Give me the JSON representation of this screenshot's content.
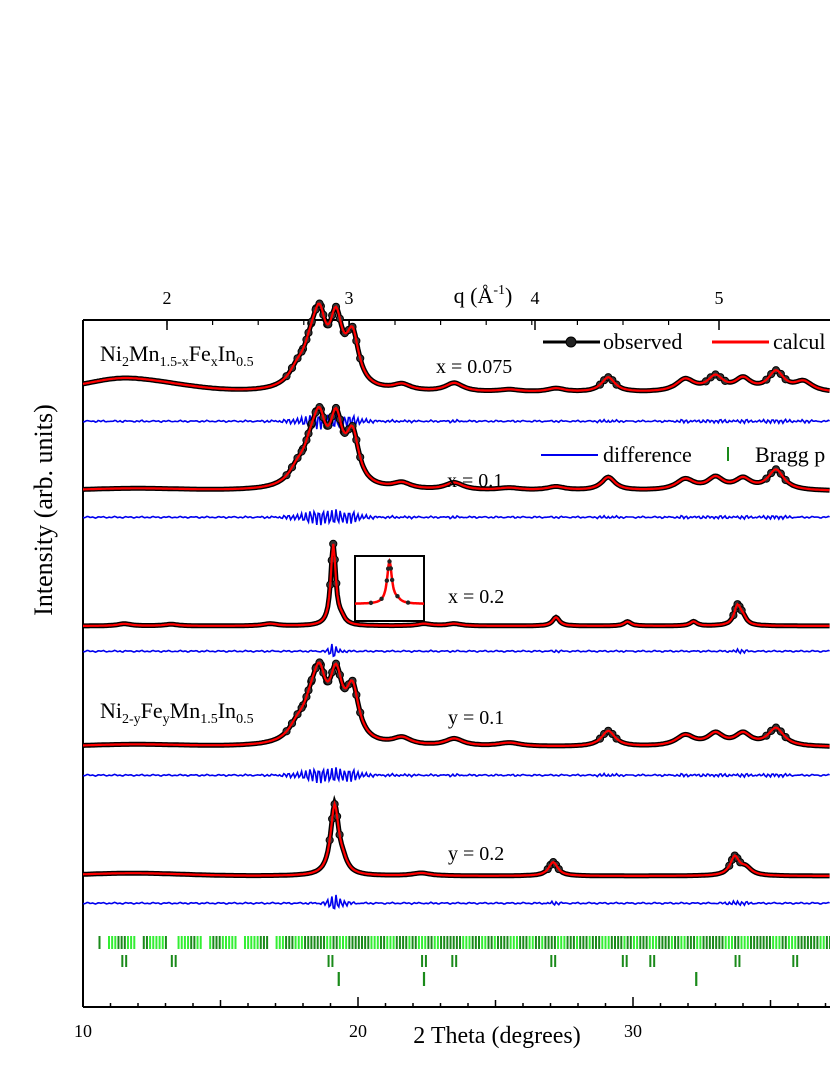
{
  "chart_data": {
    "type": "line",
    "xlabel": "2 Theta (degrees)",
    "ylabel": "Intensity (arb. units)",
    "top_axis_label": "q (Å",
    "top_axis_exp": "-1",
    "top_axis_label_end": ")",
    "xlim": [
      10,
      40
    ],
    "x_ticks": [
      "10",
      "20",
      "30"
    ],
    "q_ticks": [
      "2",
      "3",
      "4",
      "5"
    ],
    "legend": {
      "observed": "observed",
      "calculated": "calcul",
      "difference": "difference",
      "bragg": "Bragg p"
    },
    "colors": {
      "observed": "#000000",
      "calculated": "#ff0000",
      "difference": "#0000ee",
      "bragg_light": "#33ee33",
      "bragg_dark": "#1a8a1a"
    },
    "group_labels": [
      {
        "base": "Ni",
        "parts": [
          [
            "2",
            "sub"
          ],
          [
            "Mn",
            ""
          ],
          [
            "1.5-x",
            "sub"
          ],
          [
            "Fe",
            ""
          ],
          [
            "x",
            "sub"
          ],
          [
            "In",
            ""
          ],
          [
            "0.5",
            "sub"
          ]
        ]
      },
      {
        "base": "Ni",
        "parts": [
          [
            "2-y",
            "sub"
          ],
          [
            "Fe",
            ""
          ],
          [
            "y",
            "sub"
          ],
          [
            "Mn",
            ""
          ],
          [
            "1.5",
            "sub"
          ],
          [
            "In",
            ""
          ],
          [
            "0.5",
            "sub"
          ]
        ]
      }
    ],
    "series": [
      {
        "name": "x = 0.075",
        "baseline": 0.9,
        "peaks": [
          [
            11.3,
            0.3,
            1.4
          ],
          [
            17.8,
            1.2,
            0.4
          ],
          [
            18.3,
            2.5,
            0.35
          ],
          [
            18.6,
            4.4,
            0.28
          ],
          [
            19.2,
            5.0,
            0.28
          ],
          [
            19.8,
            4.0,
            0.28
          ],
          [
            21.6,
            0.5,
            0.4
          ],
          [
            23.5,
            0.7,
            0.4
          ],
          [
            25.5,
            0.2,
            0.5
          ],
          [
            27.2,
            0.3,
            0.4
          ],
          [
            29.1,
            1.2,
            0.3
          ],
          [
            31.9,
            1.0,
            0.4
          ],
          [
            33.0,
            1.2,
            0.35
          ],
          [
            34.0,
            1.0,
            0.35
          ],
          [
            35.2,
            1.6,
            0.35
          ],
          [
            36.2,
            0.8,
            0.4
          ]
        ]
      },
      {
        "name": "x = 0.1",
        "baseline": 0.2,
        "peaks": [
          [
            17.8,
            1.2,
            0.4
          ],
          [
            18.3,
            2.5,
            0.35
          ],
          [
            18.6,
            4.2,
            0.28
          ],
          [
            19.2,
            5.0,
            0.28
          ],
          [
            19.8,
            4.1,
            0.28
          ],
          [
            21.6,
            0.5,
            0.4
          ],
          [
            23.5,
            0.6,
            0.4
          ],
          [
            25.5,
            0.2,
            0.5
          ],
          [
            27.2,
            0.3,
            0.4
          ],
          [
            29.1,
            1.1,
            0.3
          ],
          [
            31.9,
            0.9,
            0.4
          ],
          [
            33.0,
            1.0,
            0.35
          ],
          [
            34.0,
            0.9,
            0.35
          ],
          [
            35.2,
            1.7,
            0.35
          ]
        ]
      },
      {
        "name": "x = 0.2",
        "baseline": 0.0,
        "peaks": [
          [
            11.5,
            0.2,
            0.3
          ],
          [
            13.2,
            0.15,
            0.3
          ],
          [
            16.8,
            0.2,
            0.3
          ],
          [
            19.1,
            7.5,
            0.11
          ],
          [
            19.4,
            0.5,
            0.15
          ],
          [
            22.4,
            0.2,
            0.3
          ],
          [
            23.5,
            0.2,
            0.3
          ],
          [
            27.2,
            0.8,
            0.15
          ],
          [
            29.8,
            0.4,
            0.15
          ],
          [
            32.2,
            0.4,
            0.15
          ],
          [
            33.8,
            1.8,
            0.15
          ],
          [
            34.0,
            0.6,
            0.15
          ]
        ]
      },
      {
        "name": "y = 0.1",
        "baseline": 0.2,
        "peaks": [
          [
            17.8,
            1.2,
            0.4
          ],
          [
            18.3,
            2.4,
            0.35
          ],
          [
            18.6,
            4.3,
            0.28
          ],
          [
            19.2,
            5.0,
            0.28
          ],
          [
            19.8,
            4.2,
            0.28
          ],
          [
            21.6,
            0.6,
            0.4
          ],
          [
            23.5,
            0.6,
            0.4
          ],
          [
            25.5,
            0.3,
            0.5
          ],
          [
            29.1,
            1.3,
            0.3
          ],
          [
            31.9,
            0.9,
            0.4
          ],
          [
            33.0,
            1.0,
            0.35
          ],
          [
            34.0,
            1.0,
            0.35
          ],
          [
            35.2,
            1.5,
            0.35
          ]
        ]
      },
      {
        "name": "y = 0.2",
        "baseline": 0.3,
        "peaks": [
          [
            19.15,
            7.5,
            0.18
          ],
          [
            19.45,
            1.0,
            0.2
          ],
          [
            22.3,
            0.3,
            0.4
          ],
          [
            27.1,
            1.5,
            0.2
          ],
          [
            33.7,
            2.0,
            0.2
          ],
          [
            34.1,
            0.8,
            0.25
          ]
        ]
      }
    ],
    "bragg_rows": [
      [
        11.5,
        13.3,
        19.0,
        22.4,
        23.5,
        27.1,
        29.7,
        30.7,
        33.8,
        35.9
      ],
      [
        19.3,
        22.4,
        32.3
      ]
    ]
  }
}
